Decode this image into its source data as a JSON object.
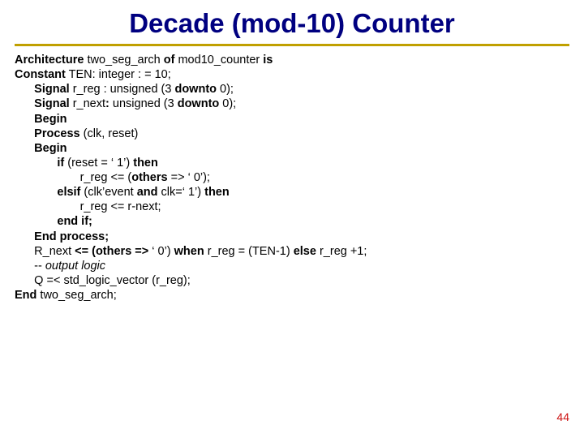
{
  "title": "Decade (mod-10) Counter",
  "page_number": "44",
  "code": {
    "l0": {
      "indent": 0,
      "pre": "Architecture",
      "mid": " two_seg_arch ",
      "post": "of",
      "tail": " mod10_counter ",
      "end": "is"
    },
    "l1": {
      "indent": 0,
      "pre": "Constant",
      "tail": " TEN: integer : = 10;"
    },
    "l2": {
      "indent": 1,
      "pre": "Signal",
      "tail": " r_reg : unsigned (3 ",
      "post": "downto",
      "end": " 0);"
    },
    "l3": {
      "indent": 1,
      "pre": "Signal",
      "tail": " r_next",
      "post": ":",
      "end2": " unsigned (3 ",
      "post2": "downto",
      "end3": " 0);"
    },
    "l4": {
      "indent": 1,
      "pre": "Begin"
    },
    "l5": {
      "indent": 1,
      "pre": "Process",
      "tail": " (clk, reset)"
    },
    "l6": {
      "indent": 1,
      "pre": "Begin"
    },
    "l7": {
      "indent": 2,
      "pre": "if",
      "tail": " (reset = ‘ 1’) ",
      "post": "then"
    },
    "l8": {
      "indent": 3,
      "tail": "r_reg <= (",
      "post": "others",
      "end": " => ‘ 0’);"
    },
    "l9": {
      "indent": 2,
      "pre": "elsif",
      "tail": " (clk’event ",
      "post": "and",
      "end": " clk=‘ 1’) ",
      "post2": "then"
    },
    "l10": {
      "indent": 3,
      "tail": "r_reg <= r-next;"
    },
    "l11": {
      "indent": 2,
      "pre": "end if;"
    },
    "l12": {
      "indent": 1,
      "pre": "End process;"
    },
    "l13": {
      "indent": 1,
      "tail": "R_next ",
      "post": "<= (others =>",
      "end": " ‘ 0’) ",
      "post2": "when",
      "end2": " r_reg = (TEN-1) ",
      "post3": "else",
      "end3": " r_reg +1;"
    },
    "l14": {
      "indent": 1,
      "tail": "-- ",
      "it": "output logic"
    },
    "l15": {
      "indent": 1,
      "tail": "Q =< std_logic_vector (r_reg);"
    },
    "l16": {
      "indent": 0,
      "pre": "End",
      "tail": " two_seg_arch;"
    }
  }
}
